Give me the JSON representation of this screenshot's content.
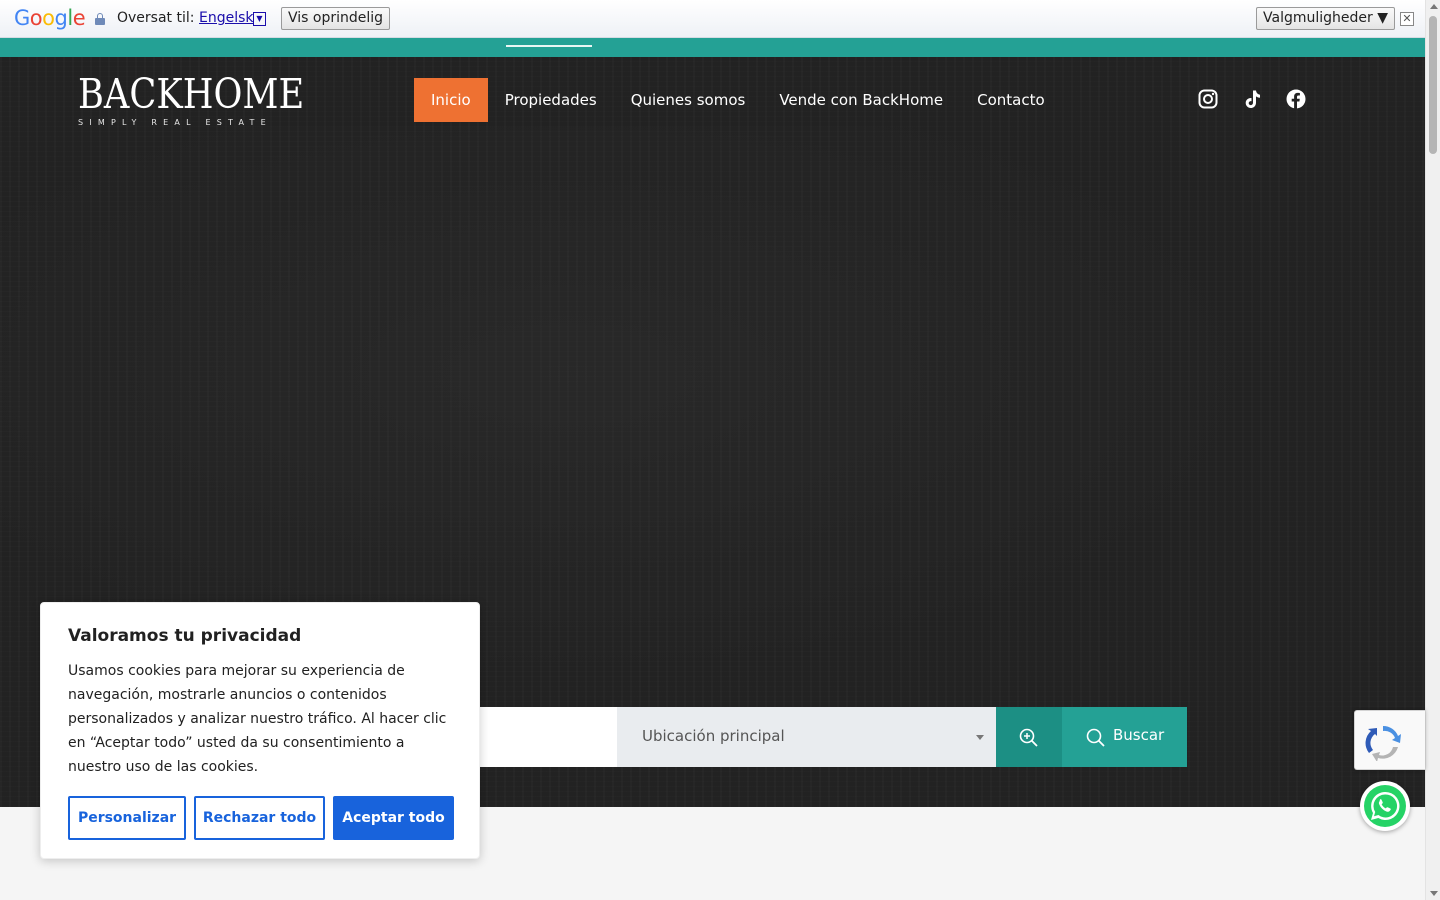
{
  "translate_bar": {
    "logo_letters": [
      "G",
      "o",
      "o",
      "g",
      "l",
      "e"
    ],
    "label": "Oversat til:",
    "language": "Engelsk",
    "language_dropdown": "▼",
    "show_original": "Vis oprindelig",
    "options": "Valgmuligheder ▼",
    "close": "✕"
  },
  "brand": {
    "name": "BACKHOME",
    "tagline": "SIMPLY REAL ESTATE"
  },
  "nav": {
    "items": [
      "Inicio",
      "Propiedades",
      "Quienes somos",
      "Vende con BackHome",
      "Contacto"
    ],
    "active": "Inicio"
  },
  "social": [
    "instagram-icon",
    "tiktok-icon",
    "facebook-icon"
  ],
  "search": {
    "location_placeholder": "Ubicación principal",
    "search_label": "Buscar"
  },
  "cookie": {
    "title": "Valoramos tu privacidad",
    "body": "Usamos cookies para mejorar su experiencia de navegación, mostrarle anuncios o contenidos personalizados y analizar nuestro tráfico. Al hacer clic en “Aceptar todo” usted da su consentimiento a nuestro uso de las cookies.",
    "customize": "Personalizar",
    "reject": "Rechazar todo",
    "accept": "Aceptar todo"
  },
  "colors": {
    "teal": "#24a195",
    "orange_active": "#ee7132",
    "cookie_blue": "#1863dc",
    "hero_bg": "#222222"
  }
}
